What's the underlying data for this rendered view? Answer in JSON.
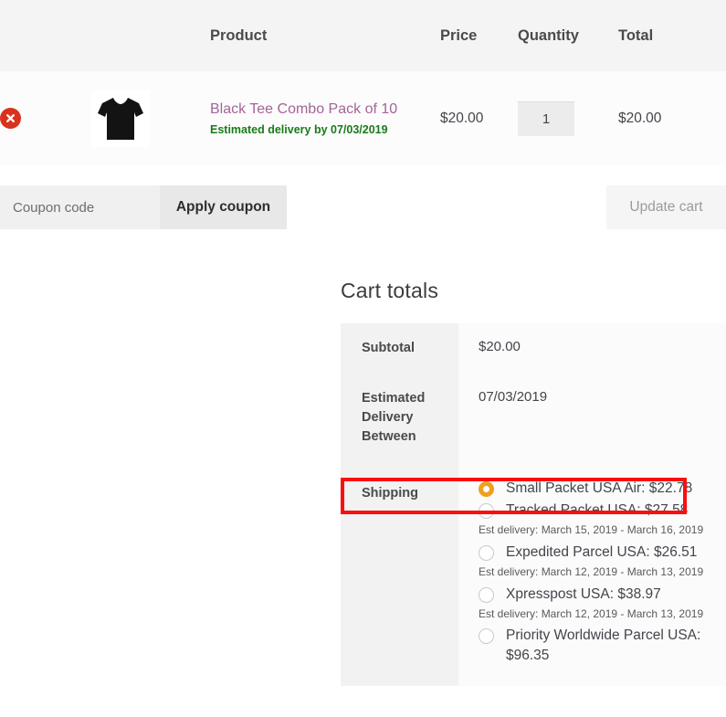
{
  "cart_table": {
    "headers": [
      "",
      "",
      "Product",
      "Price",
      "Quantity",
      "Total"
    ],
    "rows": [
      {
        "remove_label": "×",
        "remove_icon": "remove-circle-icon",
        "thumbnail_icon": "black-tshirt-image",
        "product_name": "Black Tee Combo Pack of 10",
        "product_delivery": "Estimated delivery by 07/03/2019",
        "price": "$20.00",
        "quantity": "1",
        "total": "$20.00"
      }
    ]
  },
  "actions": {
    "coupon_placeholder": "Coupon code",
    "coupon_value": "",
    "apply_coupon_label": "Apply coupon",
    "update_cart_label": "Update cart"
  },
  "cart_totals": {
    "title": "Cart totals",
    "subtotal_label": "Subtotal",
    "subtotal_value": "$20.00",
    "estimated_delivery_label": "Estimated Delivery Between",
    "estimated_delivery_value": "07/03/2019",
    "shipping_label": "Shipping",
    "shipping_options": [
      {
        "label": "Small Packet USA Air: $22.78",
        "selected": true,
        "est": ""
      },
      {
        "label": "Tracked Packet USA: $27.58",
        "selected": false,
        "est": "Est delivery: March 15, 2019 - March 16, 2019"
      },
      {
        "label": "Expedited Parcel USA: $26.51",
        "selected": false,
        "est": "Est delivery: March 12, 2019 - March 13, 2019"
      },
      {
        "label": "Xpresspost USA: $38.97",
        "selected": false,
        "est": "Est delivery: March 12, 2019 - March 13, 2019"
      },
      {
        "label": "Priority Worldwide Parcel USA: $96.35",
        "selected": false,
        "est": ""
      }
    ]
  },
  "colors": {
    "product_link": "#a46497",
    "delivery_text": "#1a7a1a",
    "remove_button": "#d9321f",
    "radio_selected": "#f0a01e",
    "highlight_border": "#fc0d10",
    "header_bg": "#f4f4f4"
  },
  "annotation": {
    "highlight_target": "shipping-row-selected-option"
  }
}
